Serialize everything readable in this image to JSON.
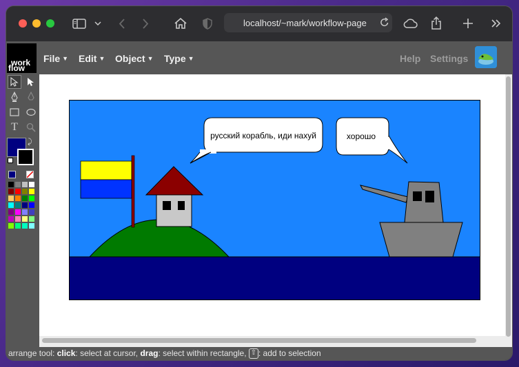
{
  "browser": {
    "url": "localhost/~mark/workflow-page"
  },
  "app": {
    "logo_line1": "work",
    "logo_line2": "flow",
    "menus": [
      "File",
      "Edit",
      "Object",
      "Type"
    ],
    "help_label": "Help",
    "settings_label": "Settings"
  },
  "drawing": {
    "speech_left": "русский корабль, иди нахуй",
    "speech_right": "хорошо"
  },
  "colors": {
    "sky": "#1a84ff",
    "sea": "#000080",
    "hill": "#007a00",
    "roof": "#8b0000",
    "flag_top": "#ffff00",
    "flag_bottom": "#0033ff",
    "ship": "#808080",
    "current_fill": "#000080"
  },
  "palette": [
    "#000000",
    "#808080",
    "#c0c0c0",
    "#ffffff",
    "#800000",
    "#ff0000",
    "#808000",
    "#ffff00",
    "#ffcc66",
    "#ff8000",
    "#008000",
    "#00ff00",
    "#00ffff",
    "#008080",
    "#000080",
    "#0000ff",
    "#800080",
    "#ff00ff",
    "#8080ff",
    "#4040c0",
    "#c000c0",
    "#ff80c0",
    "#ffff80",
    "#80ff80",
    "#80ff00",
    "#00ff80",
    "#00ffc0",
    "#80ffff"
  ],
  "status": {
    "prefix": "arrange tool: ",
    "click_key": "click",
    "click_desc": ": select at cursor, ",
    "drag_key": "drag",
    "drag_desc": ": select within rectangle, ",
    "shift_symbol": "⇧",
    "shift_desc": ": add to selection"
  }
}
